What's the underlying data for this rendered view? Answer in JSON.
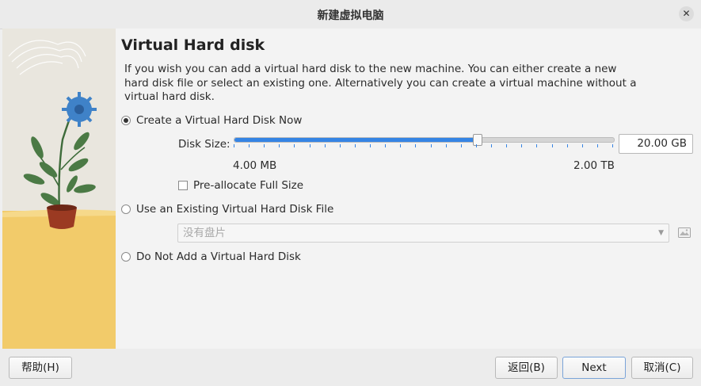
{
  "window": {
    "title": "新建虚拟电脑",
    "close_icon": "close-icon"
  },
  "page": {
    "heading": "Virtual Hard disk",
    "description": "If you wish you can add a virtual hard disk to the new machine. You can either create a new hard disk file or select an existing one. Alternatively you can create a virtual machine without a virtual hard disk."
  },
  "options": {
    "create_new": {
      "label": "Create a Virtual Hard Disk Now",
      "selected": true
    },
    "use_existing": {
      "label": "Use an Existing Virtual Hard Disk File",
      "selected": false
    },
    "do_not_add": {
      "label": "Do Not Add a Virtual Hard Disk",
      "selected": false
    }
  },
  "disk_size": {
    "label": "Disk Size:",
    "value": "20.00 GB",
    "min_label": "4.00 MB",
    "max_label": "2.00 TB",
    "slider_fraction": 0.64
  },
  "preallocate": {
    "label": "Pre-allocate Full Size",
    "checked": false
  },
  "existing_disk": {
    "placeholder": "没有盘片",
    "folder_icon": "folder-open-icon"
  },
  "buttons": {
    "help": "帮助(H)",
    "back": "返回(B)",
    "next": "Next",
    "cancel": "取消(C)"
  },
  "colors": {
    "accent": "#3584e4",
    "side_top": "#e9e6de",
    "side_bottom": "#f2cb6a"
  }
}
